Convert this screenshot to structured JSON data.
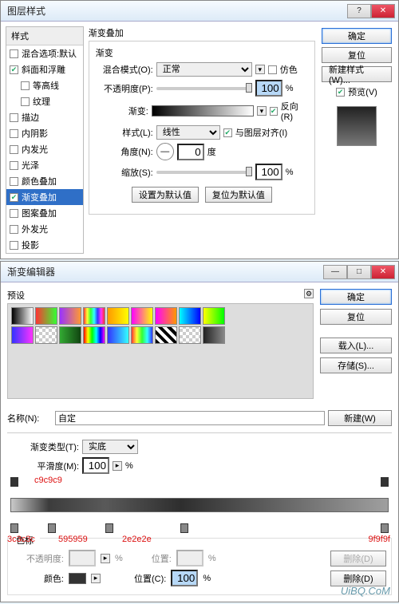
{
  "win1": {
    "title": "图层样式",
    "styles_header": "样式",
    "styles": [
      {
        "label": "混合选项:默认",
        "checked": false,
        "bold": true
      },
      {
        "label": "斜面和浮雕",
        "checked": true
      },
      {
        "label": "等高线",
        "checked": false,
        "indent": true
      },
      {
        "label": "纹理",
        "checked": false,
        "indent": true
      },
      {
        "label": "描边",
        "checked": false
      },
      {
        "label": "内阴影",
        "checked": false
      },
      {
        "label": "内发光",
        "checked": false
      },
      {
        "label": "光泽",
        "checked": false
      },
      {
        "label": "颜色叠加",
        "checked": false
      },
      {
        "label": "渐变叠加",
        "checked": true,
        "selected": true
      },
      {
        "label": "图案叠加",
        "checked": false
      },
      {
        "label": "外发光",
        "checked": false
      },
      {
        "label": "投影",
        "checked": false
      }
    ],
    "section_title": "渐变叠加",
    "sub_title": "渐变",
    "blend_mode": {
      "label": "混合模式(O):",
      "value": "正常",
      "dither_label": "仿色",
      "dither": false
    },
    "opacity": {
      "label": "不透明度(P):",
      "value": "100",
      "unit": "%"
    },
    "gradient": {
      "label": "渐变:",
      "reverse_label": "反向(R)",
      "reverse": true
    },
    "style": {
      "label": "样式(L):",
      "value": "线性",
      "align_label": "与图层对齐(I)",
      "align": true
    },
    "angle": {
      "label": "角度(N):",
      "value": "0",
      "unit": "度"
    },
    "scale": {
      "label": "缩放(S):",
      "value": "100",
      "unit": "%"
    },
    "defaults": {
      "set": "设置为默认值",
      "reset": "复位为默认值"
    },
    "right": {
      "ok": "确定",
      "cancel": "复位",
      "newstyle": "新建样式(W)...",
      "preview_label": "预览(V)",
      "preview": true
    }
  },
  "win2": {
    "title": "渐变编辑器",
    "presets_label": "预设",
    "gear": "⚙",
    "thumb_colors": [
      "linear-gradient(90deg,#000,#fff)",
      "linear-gradient(90deg,#f33,#3f3)",
      "linear-gradient(90deg,#93f,#f93)",
      "linear-gradient(90deg,#f33,#ff3,#3f3,#3ff,#33f,#f3f,#f33)",
      "linear-gradient(90deg,#f90,#ff0)",
      "linear-gradient(90deg,#f0f,#ff0)",
      "linear-gradient(90deg,#f0f,#f90)",
      "linear-gradient(90deg,#0ff,#00f)",
      "linear-gradient(90deg,#ff0,#0f0)",
      "linear-gradient(90deg,#33f,#f3f)",
      "repeating-conic-gradient(#ccc 0 25%,#fff 0 50%) 0/8px 8px",
      "linear-gradient(90deg,#3a3,#141)",
      "linear-gradient(90deg,#f00,#ff0,#0f0,#0ff,#00f,#f0f)",
      "linear-gradient(90deg,#33f,#3ff)",
      "linear-gradient(90deg,#f33,#ff3,#3f3,#3ff,#33f)",
      "repeating-linear-gradient(45deg,#000 0 4px,#fff 4px 8px)",
      "repeating-conic-gradient(#ccc 0 25%,#fff 0 50%) 0/8px 8px",
      "linear-gradient(90deg,#222,#888)"
    ],
    "buttons": {
      "ok": "确定",
      "cancel": "复位",
      "load": "载入(L)...",
      "save": "存储(S)..."
    },
    "name": {
      "label": "名称(N):",
      "value": "自定",
      "new": "新建(W)"
    },
    "grad_type": {
      "label": "渐变类型(T):",
      "value": "实底"
    },
    "smooth": {
      "label": "平滑度(M):",
      "value": "100",
      "unit": "%"
    },
    "ann": {
      "top": "c9c9c9",
      "b1": "3c3c3c",
      "b2": "595959",
      "b3": "2e2e2e",
      "b4": "9f9f9f"
    },
    "stops": {
      "title": "色标",
      "op": {
        "label": "不透明度:",
        "val": "",
        "unit": "%",
        "pos_label": "位置:",
        "pos": "",
        "del": "删除(D)"
      },
      "col": {
        "label": "颜色:",
        "pos_label": "位置(C):",
        "pos": "100",
        "unit": "%",
        "del": "删除(D)"
      }
    },
    "watermark": "UiBQ.CoM"
  }
}
